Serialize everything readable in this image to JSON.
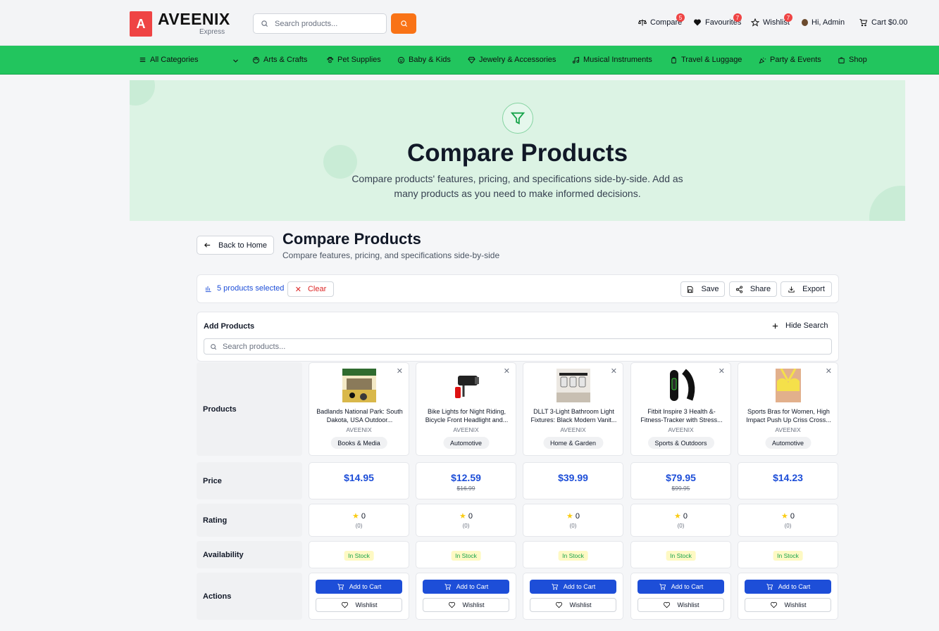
{
  "header": {
    "logo_letter": "A",
    "brand": "AVEENIX",
    "brand_sub": "Express",
    "search_placeholder": "Search products...",
    "compare_label": "Compare",
    "compare_count": "5",
    "favourites_label": "Favourites",
    "favourites_count": "7",
    "wishlist_label": "Wishlist",
    "wishlist_count": "7",
    "user_label": "Hi, Admin",
    "cart_label": "Cart $0.00"
  },
  "nav": {
    "all_categories": "All Categories",
    "items": [
      "Arts & Crafts",
      "Pet Supplies",
      "Baby & Kids",
      "Jewelry & Accessories",
      "Musical Instruments",
      "Travel & Luggage",
      "Party & Events",
      "Shop"
    ]
  },
  "hero": {
    "title": "Compare Products",
    "description": "Compare products' features, pricing, and specifications side-by-side. Add as many products as you need to make informed decisions."
  },
  "page": {
    "back_label": "Back to Home",
    "title": "Compare Products",
    "subtitle": "Compare features, pricing, and specifications side-by-side"
  },
  "toolbar": {
    "selected_label": "5 products selected",
    "clear_label": "Clear",
    "save_label": "Save",
    "share_label": "Share",
    "export_label": "Export"
  },
  "add_products": {
    "title": "Add Products",
    "hide_label": "Hide Search",
    "search_placeholder": "Search products..."
  },
  "rows": {
    "products": "Products",
    "price": "Price",
    "rating": "Rating",
    "availability": "Availability",
    "actions": "Actions"
  },
  "actions": {
    "add_to_cart": "Add to Cart",
    "wishlist": "Wishlist"
  },
  "products": [
    {
      "name": "Badlands National Park: South Dakota, USA Outdoor...",
      "brand": "AVEENIX",
      "category": "Books & Media",
      "price": "$14.95",
      "old_price": "",
      "rating": "0",
      "reviews": "(0)",
      "stock": "In Stock"
    },
    {
      "name": "Bike Lights for Night Riding, Bicycle Front Headlight and...",
      "brand": "AVEENIX",
      "category": "Automotive",
      "price": "$12.59",
      "old_price": "$16.99",
      "rating": "0",
      "reviews": "(0)",
      "stock": "In Stock"
    },
    {
      "name": "DLLT 3-Light Bathroom Light Fixtures: Black Modern Vanit...",
      "brand": "AVEENIX",
      "category": "Home & Garden",
      "price": "$39.99",
      "old_price": "",
      "rating": "0",
      "reviews": "(0)",
      "stock": "In Stock"
    },
    {
      "name": "Fitbit Inspire 3 Health &- Fitness-Tracker with Stress...",
      "brand": "AVEENIX",
      "category": "Sports & Outdoors",
      "price": "$79.95",
      "old_price": "$99.95",
      "rating": "0",
      "reviews": "(0)",
      "stock": "In Stock"
    },
    {
      "name": "Sports Bras for Women, High Impact Push Up Criss Cross...",
      "brand": "AVEENIX",
      "category": "Automotive",
      "price": "$14.23",
      "old_price": "",
      "rating": "0",
      "reviews": "(0)",
      "stock": "In Stock"
    }
  ],
  "colors": {
    "brand_red": "#ef4444",
    "nav_green": "#22c55e",
    "search_orange": "#f97316",
    "primary_blue": "#1d4ed8"
  }
}
